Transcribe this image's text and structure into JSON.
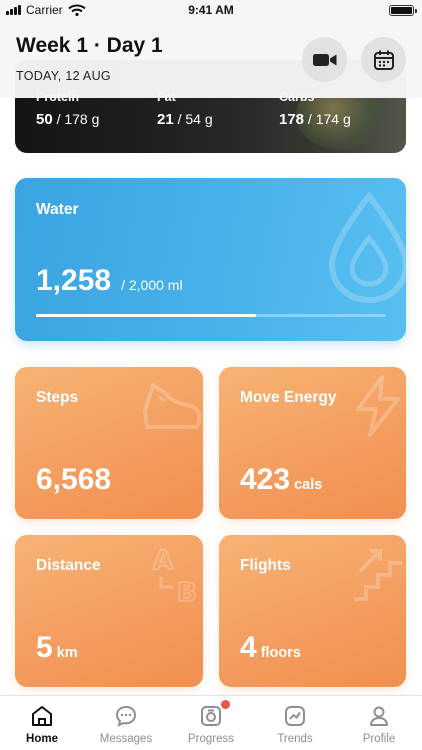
{
  "status_bar": {
    "carrier": "Carrier",
    "time": "9:41 AM"
  },
  "header": {
    "title": "Week 1 · Day 1",
    "date": "TODAY, 12 AUG",
    "video_icon": "video-camera-icon",
    "calendar_icon": "calendar-icon"
  },
  "macros": [
    {
      "label": "Protein",
      "current": "50",
      "target": "/ 178 g"
    },
    {
      "label": "Fat",
      "current": "21",
      "target": "/ 54 g"
    },
    {
      "label": "Carbs",
      "current": "178",
      "target": "/ 174 g"
    }
  ],
  "water": {
    "label": "Water",
    "value": "1,258",
    "target": "/  2,000 ml",
    "progress": 0.629
  },
  "steps": {
    "label": "Steps",
    "value": "6,568",
    "unit": ""
  },
  "move_energy": {
    "label": "Move Energy",
    "value": "423",
    "unit": "cals"
  },
  "distance": {
    "label": "Distance",
    "value": "5",
    "unit": "km"
  },
  "flights": {
    "label": "Flights",
    "value": "4",
    "unit": "floors"
  },
  "tabs": [
    {
      "label": "Home",
      "icon": "home-icon",
      "active": true
    },
    {
      "label": "Messages",
      "icon": "chat-icon",
      "active": false
    },
    {
      "label": "Progress",
      "icon": "progress-photo-icon",
      "active": false,
      "badge": true
    },
    {
      "label": "Trends",
      "icon": "trends-icon",
      "active": false
    },
    {
      "label": "Profile",
      "icon": "profile-icon",
      "active": false
    }
  ],
  "colors": {
    "water": "#46b0ea",
    "orange": "#f39c5e",
    "badge": "#f0524b"
  }
}
